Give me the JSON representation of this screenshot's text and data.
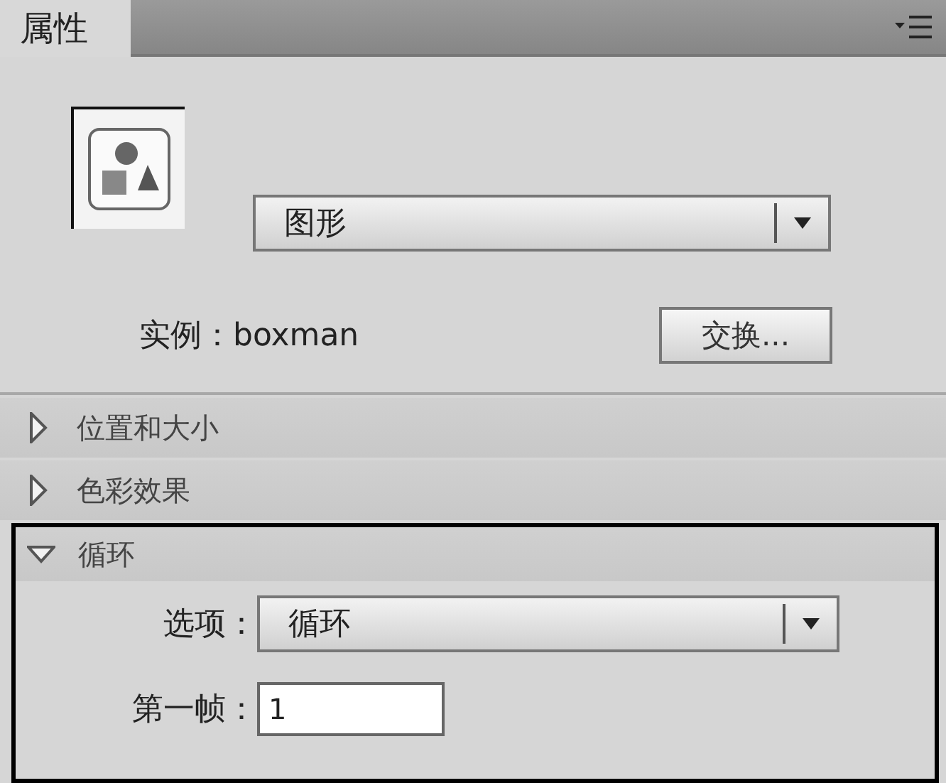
{
  "panel_tab": {
    "label": "属性",
    "selected": true
  },
  "symbol": {
    "type_dropdown": "图形"
  },
  "instance": {
    "text": "实例：boxman",
    "swap_button": "交换..."
  },
  "sections": [
    {
      "title": "位置和大小",
      "expanded": false,
      "highlighted": false
    },
    {
      "title": "色彩效果",
      "expanded": false,
      "highlighted": false
    },
    {
      "title": "循环",
      "expanded": true,
      "highlighted": true,
      "fields": [
        {
          "kind": "dropdown",
          "label": "选项：",
          "value": "循环"
        },
        {
          "kind": "input",
          "label": "第一帧：",
          "value": "1"
        }
      ]
    }
  ]
}
